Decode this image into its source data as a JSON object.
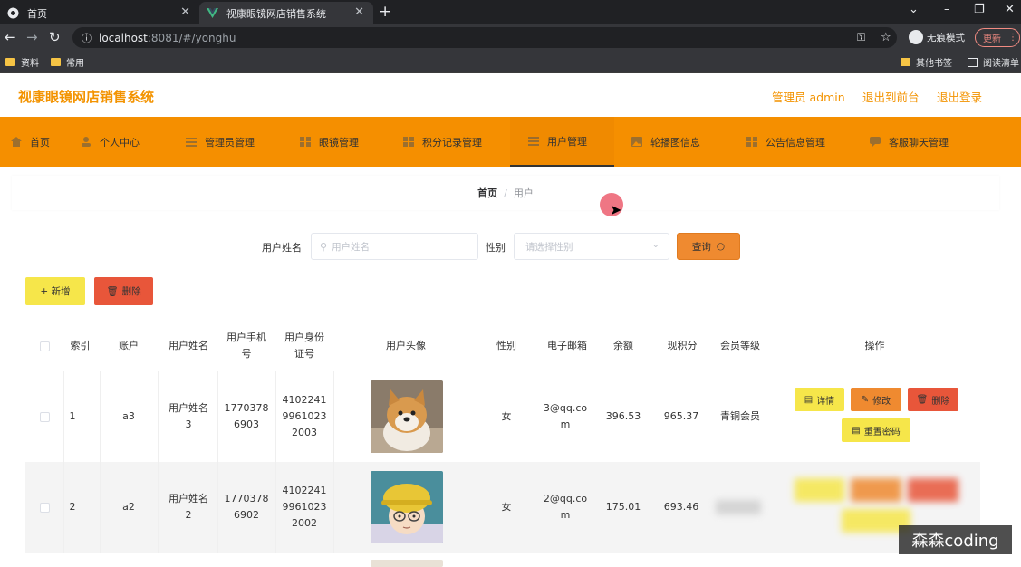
{
  "browser": {
    "tabs": [
      {
        "title": "首页"
      },
      {
        "title": "视康眼镜网店销售系统"
      }
    ],
    "url_host": "localhost",
    "url_path": ":8081/#/yonghu",
    "incognito_label": "无痕模式",
    "update_label": "更新",
    "bookmarks": [
      "资料",
      "常用"
    ],
    "other_bookmarks": "其他书签",
    "reading_list": "阅读清单"
  },
  "header": {
    "title": "视康眼镜网店销售系统",
    "admin_label": "管理员 admin",
    "back_label": "退出到前台",
    "logout_label": "退出登录"
  },
  "nav": {
    "items": [
      {
        "label": "首页"
      },
      {
        "label": "个人中心"
      },
      {
        "label": "管理员管理"
      },
      {
        "label": "眼镜管理"
      },
      {
        "label": "积分记录管理"
      },
      {
        "label": "用户管理"
      },
      {
        "label": "轮播图信息"
      },
      {
        "label": "公告信息管理"
      },
      {
        "label": "客服聊天管理"
      }
    ],
    "active_index": 5
  },
  "breadcrumb": {
    "home": "首页",
    "separator": "/",
    "current": "用户"
  },
  "search": {
    "name_label": "用户姓名",
    "name_placeholder": "用户姓名",
    "gender_label": "性别",
    "gender_placeholder": "请选择性别",
    "query_label": "查询"
  },
  "actions": {
    "add_label": "+ 新增",
    "delete_label": "删除"
  },
  "table": {
    "headers": [
      "索引",
      "账户",
      "用户姓名",
      "用户手机号",
      "用户身份证号",
      "用户头像",
      "性别",
      "电子邮箱",
      "余额",
      "现积分",
      "会员等级",
      "操作"
    ],
    "rows": [
      {
        "index": "1",
        "account": "a3",
        "name": "用户姓名3",
        "phone": "17703786903",
        "id_card": "410224199610232003",
        "gender": "女",
        "email": "3@qq.com",
        "balance": "396.53",
        "points": "965.37",
        "level": "青铜会员"
      },
      {
        "index": "2",
        "account": "a2",
        "name": "用户姓名2",
        "phone": "17703786902",
        "id_card": "410224199610232002",
        "gender": "女",
        "email": "2@qq.com",
        "balance": "175.01",
        "points": "693.46",
        "level": ""
      }
    ],
    "row_actions": {
      "detail": "详情",
      "edit": "修改",
      "delete": "删除",
      "reset": "重置密码"
    }
  },
  "watermark": "森森coding",
  "colors": {
    "accent": "#f39300",
    "nav_bg": "#f58f00",
    "yellow_btn": "#f6e64a",
    "orange_btn": "#ef8a30",
    "red_btn": "#e8563a"
  }
}
